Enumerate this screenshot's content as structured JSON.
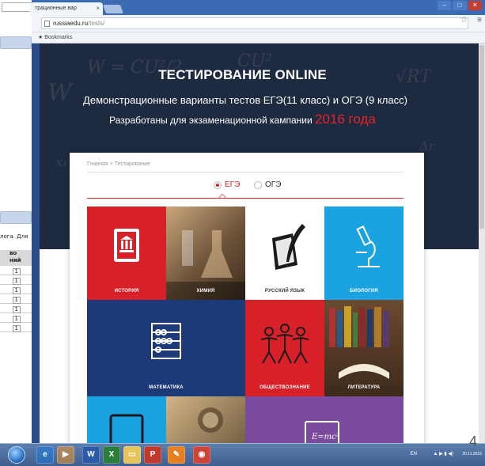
{
  "left_doc": {
    "note": "лога. Для",
    "table_header": "во\nний",
    "cells": [
      "1",
      "1",
      "1",
      "1",
      "1",
      "1",
      "1"
    ]
  },
  "browser": {
    "tab_title": "трационные вар",
    "tab_close": "×",
    "url_host": "russiaedu.ru",
    "url_path": "/tests/",
    "bookmarks_label": "★ Bookmarks"
  },
  "hero": {
    "title": "ТЕСТИРОВАНИЕ ONLINE",
    "subtitle": "Демонстрационные варианты тестов ЕГЭ(11 класс) и ОГЭ (9 класс)",
    "subtitle2_prefix": "Разработаны для экзаменационной кампании ",
    "subtitle2_highlight": "2016 года"
  },
  "breadcrumb": "Главная  >  Тестирование",
  "exam_options": [
    {
      "label": "ЕГЭ",
      "selected": true
    },
    {
      "label": "ОГЭ",
      "selected": false
    }
  ],
  "subjects": [
    {
      "name": "История",
      "color": "#d72027"
    },
    {
      "name": "Химия",
      "color": "#8a7358"
    },
    {
      "name": "Русский язык",
      "color": "#ffffff"
    },
    {
      "name": "Биология",
      "color": "#1aa3e0"
    },
    {
      "name": "Математика",
      "color": "#1d3a78"
    },
    {
      "name": "Обществознание",
      "color": "#d72027"
    },
    {
      "name": "Литература",
      "color": "#6b4a30"
    },
    {
      "name": "",
      "color": "#1aa3e0"
    },
    {
      "name": "",
      "color": "#7b6a4f"
    },
    {
      "name": "",
      "color": "#7a4a9c"
    }
  ],
  "taskbar": {
    "lang": "EN",
    "date": "20.11.2015",
    "page_number": "4"
  }
}
